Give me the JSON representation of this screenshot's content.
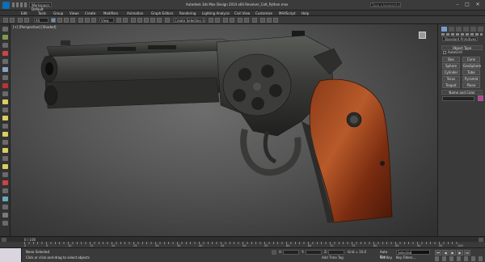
{
  "app": {
    "title": "Autodesk 3ds Max Design 2014 x64    Revolver_Colt_Python.max",
    "workspace_value": "Workspace: Default",
    "search_placeholder": "Type a keyword or phrase"
  },
  "menu": [
    "Edit",
    "Tools",
    "Group",
    "Views",
    "Create",
    "Modifiers",
    "Animation",
    "Graph Editors",
    "Rendering",
    "Lighting Analysis",
    "Civil View",
    "Customize",
    "MAXScript",
    "Help"
  ],
  "toolbar": {
    "selection_filter": "All",
    "view_ref": "View",
    "named_sel": "Create Selection Se"
  },
  "viewport": {
    "label": "[+] [Perspective] [Shaded]"
  },
  "command_panel": {
    "dropdown": "Standard Primitives",
    "object_type_title": "Object Type",
    "autogrid_label": "AutoGrid",
    "buttons": [
      "Box",
      "Cone",
      "Sphere",
      "GeoSphere",
      "Cylinder",
      "Tube",
      "Torus",
      "Pyramid",
      "Teapot",
      "Plane"
    ],
    "name_color_title": "Name and Color",
    "name_value": "",
    "color_swatch": "#c8399c"
  },
  "timeline": {
    "frame_counter": "0 / 100",
    "ticks": [
      "0",
      "5",
      "10",
      "15",
      "20",
      "25",
      "30",
      "35",
      "40",
      "45",
      "50",
      "55",
      "60",
      "65",
      "70",
      "75",
      "80",
      "85",
      "90",
      "95",
      "100"
    ]
  },
  "status": {
    "selected": "None Selected",
    "prompt": "Click or click-and-drag to select objects",
    "x_label": "X:",
    "y_label": "Y:",
    "z_label": "Z:",
    "grid": "Grid = 10.0",
    "add_time_tag": "Add Time Tag",
    "auto_key": "Auto Key",
    "selected_dropdown": "Selected",
    "set_key": "Set Key",
    "key_filters": "Key Filters..."
  }
}
